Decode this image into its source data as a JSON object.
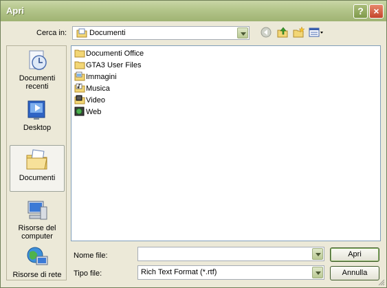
{
  "window": {
    "title": "Apri"
  },
  "lookin": {
    "label": "Cerca in:",
    "value": "Documenti"
  },
  "places": [
    {
      "label_line1": "Documenti",
      "label_line2": "recenti",
      "icon": "recent-documents-icon"
    },
    {
      "label_line1": "Desktop",
      "label_line2": "",
      "icon": "desktop-icon"
    },
    {
      "label_line1": "Documenti",
      "label_line2": "",
      "icon": "my-documents-icon"
    },
    {
      "label_line1": "Risorse del",
      "label_line2": "computer",
      "icon": "my-computer-icon"
    },
    {
      "label_line1": "Risorse di rete",
      "label_line2": "",
      "icon": "network-icon"
    }
  ],
  "files": [
    {
      "name": "Documenti Office",
      "icon": "folder-icon"
    },
    {
      "name": "GTA3 User Files",
      "icon": "folder-icon"
    },
    {
      "name": "Immagini",
      "icon": "pictures-folder-icon"
    },
    {
      "name": "Musica",
      "icon": "music-folder-icon"
    },
    {
      "name": "Video",
      "icon": "video-folder-icon"
    },
    {
      "name": "Web",
      "icon": "web-folder-icon"
    }
  ],
  "filename": {
    "label": "Nome file:",
    "value": ""
  },
  "filetype": {
    "label": "Tipo file:",
    "value": "Rich Text Format (*.rtf)"
  },
  "buttons": {
    "open": "Apri",
    "cancel": "Annulla"
  },
  "titlebar": {
    "help": "?",
    "close": "×"
  }
}
